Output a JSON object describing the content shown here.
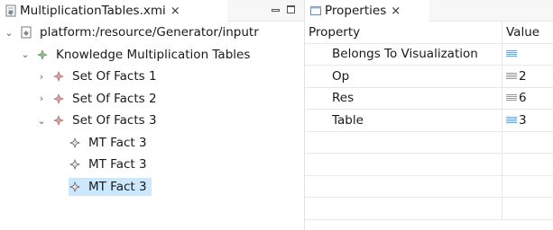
{
  "editor": {
    "tab_label": "MultiplicationTables.xmi",
    "tab_close": "×",
    "tree": [
      {
        "label": "platform:/resource/Generator/inputr",
        "depth": 0,
        "twistie": "⌄",
        "icon": "resource-icon"
      },
      {
        "label": "Knowledge Multiplication Tables",
        "depth": 1,
        "twistie": "⌄",
        "icon": "class-node-icon"
      },
      {
        "label": "Set Of Facts 1",
        "depth": 2,
        "twistie": "›",
        "icon": "class-node-icon"
      },
      {
        "label": "Set Of Facts 2",
        "depth": 2,
        "twistie": "›",
        "icon": "class-node-icon"
      },
      {
        "label": "Set Of Facts 3",
        "depth": 2,
        "twistie": "⌄",
        "icon": "class-node-icon"
      },
      {
        "label": "MT Fact 3",
        "depth": 3,
        "twistie": "",
        "icon": "class-node-icon"
      },
      {
        "label": "MT Fact 3",
        "depth": 3,
        "twistie": "",
        "icon": "class-node-icon"
      },
      {
        "label": "MT Fact 3",
        "depth": 3,
        "twistie": "",
        "icon": "class-node-icon",
        "selected": true
      }
    ]
  },
  "properties": {
    "tab_label": "Properties",
    "tab_close": "×",
    "header": {
      "property": "Property",
      "value": "Value"
    },
    "rows": [
      {
        "property": "Belongs To Visualization",
        "value": ""
      },
      {
        "property": "Op",
        "value": "2"
      },
      {
        "property": "Res",
        "value": "6"
      },
      {
        "property": "Table",
        "value": "3"
      },
      {
        "property": "",
        "value": ""
      },
      {
        "property": "",
        "value": ""
      },
      {
        "property": "",
        "value": ""
      },
      {
        "property": "",
        "value": ""
      }
    ]
  }
}
